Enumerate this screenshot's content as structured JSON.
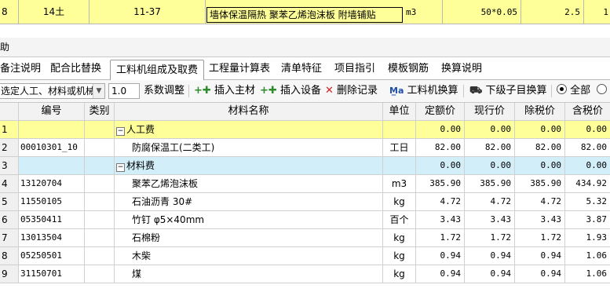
{
  "top_row": {
    "row_no": "8",
    "category": "14土",
    "code": "11-37",
    "name": "墙体保温隔热 聚苯乙烯泡沫板 附墙铺贴",
    "unit": "m3",
    "quantity_expr": "50*0.05",
    "quantity": "2.5",
    "extra": "1"
  },
  "section_title": "助",
  "tabs": [
    {
      "label": "备注说明"
    },
    {
      "label": "配合比替换"
    },
    {
      "label": "工料机组成及取费"
    },
    {
      "label": "工程量计算表"
    },
    {
      "label": "清单特征"
    },
    {
      "label": "项目指引"
    },
    {
      "label": "模板钢筋"
    },
    {
      "label": "换算说明"
    }
  ],
  "toolbar": {
    "filter_combo": "选定人工、材料或机械",
    "coef_value": "1.0",
    "coef_label": "系数调整",
    "insert_main": "插入主材",
    "insert_equip": "插入设备",
    "delete_record": "删除记录",
    "labor_convert": "工料机换算",
    "sub_convert": "下级子目换算",
    "radio_all": "全部"
  },
  "columns": [
    "编号",
    "类别",
    "材料名称",
    "单位",
    "定额价",
    "现行价",
    "除税价",
    "含税价"
  ],
  "rows": [
    {
      "n": "1",
      "code": "",
      "cat": "",
      "name": "人工费",
      "unit": "",
      "p1": "0.00",
      "p2": "0.00",
      "p3": "0.00",
      "p4": "0.00",
      "group": true
    },
    {
      "n": "2",
      "code": "00010301_10",
      "cat": "",
      "name": "防腐保温工(二类工)",
      "unit": "工日",
      "p1": "82.00",
      "p2": "82.00",
      "p3": "82.00",
      "p4": "82.00"
    },
    {
      "n": "3",
      "code": "",
      "cat": "",
      "name": "材料费",
      "unit": "",
      "p1": "0.00",
      "p2": "0.00",
      "p3": "0.00",
      "p4": "0.00",
      "group": true
    },
    {
      "n": "4",
      "code": "13120704",
      "cat": "",
      "name": "聚苯乙烯泡沫板",
      "unit": "m3",
      "p1": "385.90",
      "p2": "385.90",
      "p3": "385.90",
      "p4": "434.92"
    },
    {
      "n": "5",
      "code": "11550105",
      "cat": "",
      "name": "石油沥青 30#",
      "unit": "kg",
      "p1": "4.72",
      "p2": "4.72",
      "p3": "4.72",
      "p4": "5.32"
    },
    {
      "n": "6",
      "code": "05350411",
      "cat": "",
      "name": "竹钉 φ5×40mm",
      "unit": "百个",
      "p1": "3.43",
      "p2": "3.43",
      "p3": "3.43",
      "p4": "3.87"
    },
    {
      "n": "7",
      "code": "13013504",
      "cat": "",
      "name": "石棉粉",
      "unit": "kg",
      "p1": "1.72",
      "p2": "1.72",
      "p3": "1.72",
      "p4": "1.93"
    },
    {
      "n": "8",
      "code": "05250501",
      "cat": "",
      "name": "木柴",
      "unit": "kg",
      "p1": "0.94",
      "p2": "0.94",
      "p3": "0.94",
      "p4": "1.06"
    },
    {
      "n": "9",
      "code": "31150701",
      "cat": "",
      "name": "煤",
      "unit": "kg",
      "p1": "0.94",
      "p2": "0.94",
      "p3": "0.94",
      "p4": "1.06"
    }
  ],
  "colors": {
    "highlight_yellow": "#ffff99",
    "group_blue": "#d2eef8"
  }
}
